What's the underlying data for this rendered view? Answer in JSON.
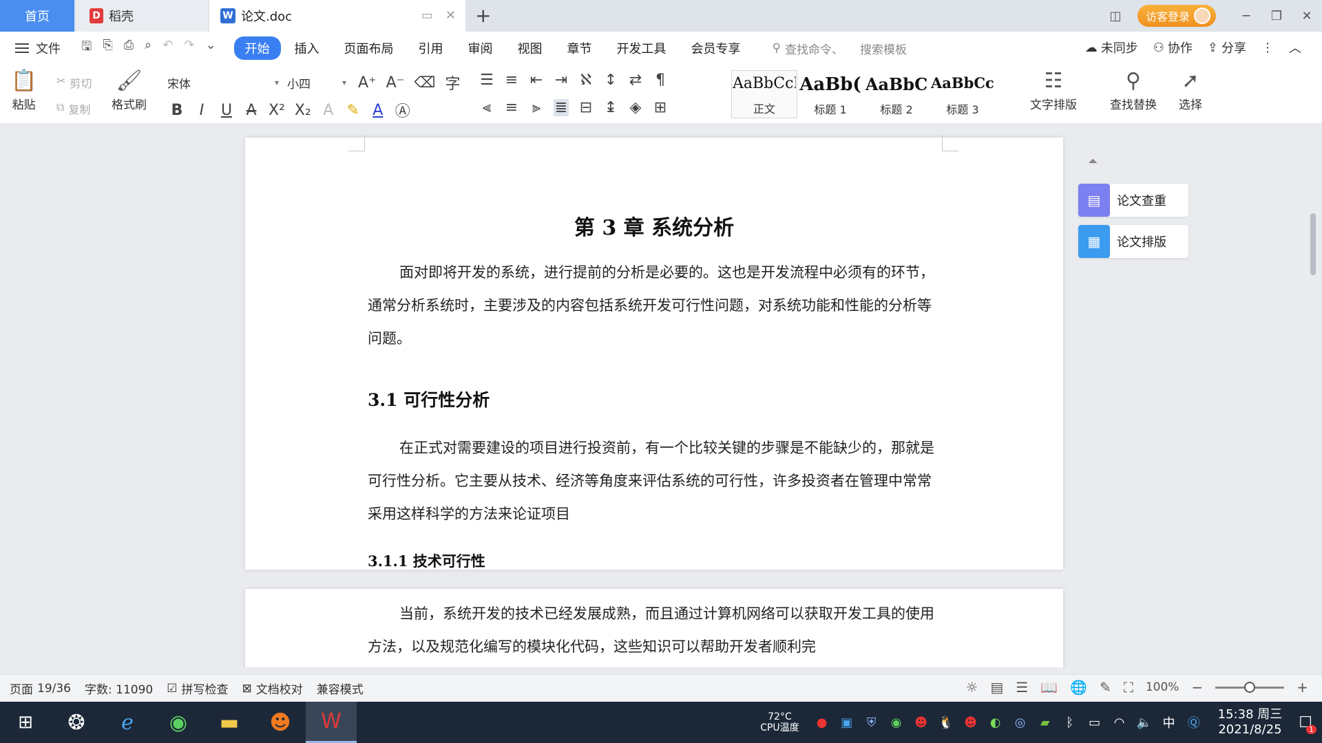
{
  "titlebar": {
    "tabs": [
      {
        "label": "首页"
      },
      {
        "label": "稻壳",
        "logo": "D"
      },
      {
        "label": "论文.doc",
        "logo": "W"
      }
    ],
    "login_label": "访客登录"
  },
  "menubar": {
    "file_label": "文件",
    "tabs": [
      "开始",
      "插入",
      "页面布局",
      "引用",
      "审阅",
      "视图",
      "章节",
      "开发工具",
      "会员专享"
    ],
    "search_placeholder": "查找命令、搜索模板",
    "search_cmd": "查找命令、",
    "search_tpl": "搜索模板",
    "sync_label": "未同步",
    "collab_label": "协作",
    "share_label": "分享"
  },
  "ribbon": {
    "paste": "粘贴",
    "cut": "剪切",
    "copy": "复制",
    "format_painter": "格式刷",
    "font_name": "宋体",
    "font_size": "小四",
    "styles": [
      {
        "preview": "AaBbCcI",
        "name": "正文"
      },
      {
        "preview": "AaBb(",
        "name": "标题 1"
      },
      {
        "preview": "AaBbC",
        "name": "标题 2"
      },
      {
        "preview": "AaBbCcI",
        "name": "标题 3"
      }
    ],
    "text_layout": "文字排版",
    "find_replace": "查找替换",
    "select": "选择"
  },
  "document": {
    "chapter_title": "第 3 章  系统分析",
    "para1": "面对即将开发的系统，进行提前的分析是必要的。这也是开发流程中必须有的环节，通常分析系统时，主要涉及的内容包括系统开发可行性问题，对系统功能和性能的分析等问题。",
    "section_3_1": "3.1  可行性分析",
    "para2": "在正式对需要建设的项目进行投资前，有一个比较关键的步骤是不能缺少的，那就是可行性分析。它主要从技术、经济等角度来评估系统的可行性，许多投资者在管理中常常采用这样科学的方法来论证项目",
    "section_3_1_1": "3.1.1  技术可行性",
    "para3": "当前，系统开发的技术已经发展成熟，而且通过计算机网络可以获取开发工具的使用方法，以及规范化编写的模块化代码，这些知识可以帮助开发者顺利完"
  },
  "side_panel": {
    "check_label": "论文查重",
    "layout_label": "论文排版"
  },
  "statusbar": {
    "page_label": "页面",
    "page_value": "19/36",
    "word_count": "字数: 11090",
    "spell_check": "拼写检查",
    "doc_proof": "文档校对",
    "compat_mode": "兼容模式",
    "zoom": "100%",
    "zoom_level": 0.5
  },
  "taskbar": {
    "cpu_temp": "72°C",
    "cpu_label": "CPU温度",
    "time": "15:38 周三",
    "date": "2021/8/25",
    "ime": "中",
    "notifications": "1"
  }
}
